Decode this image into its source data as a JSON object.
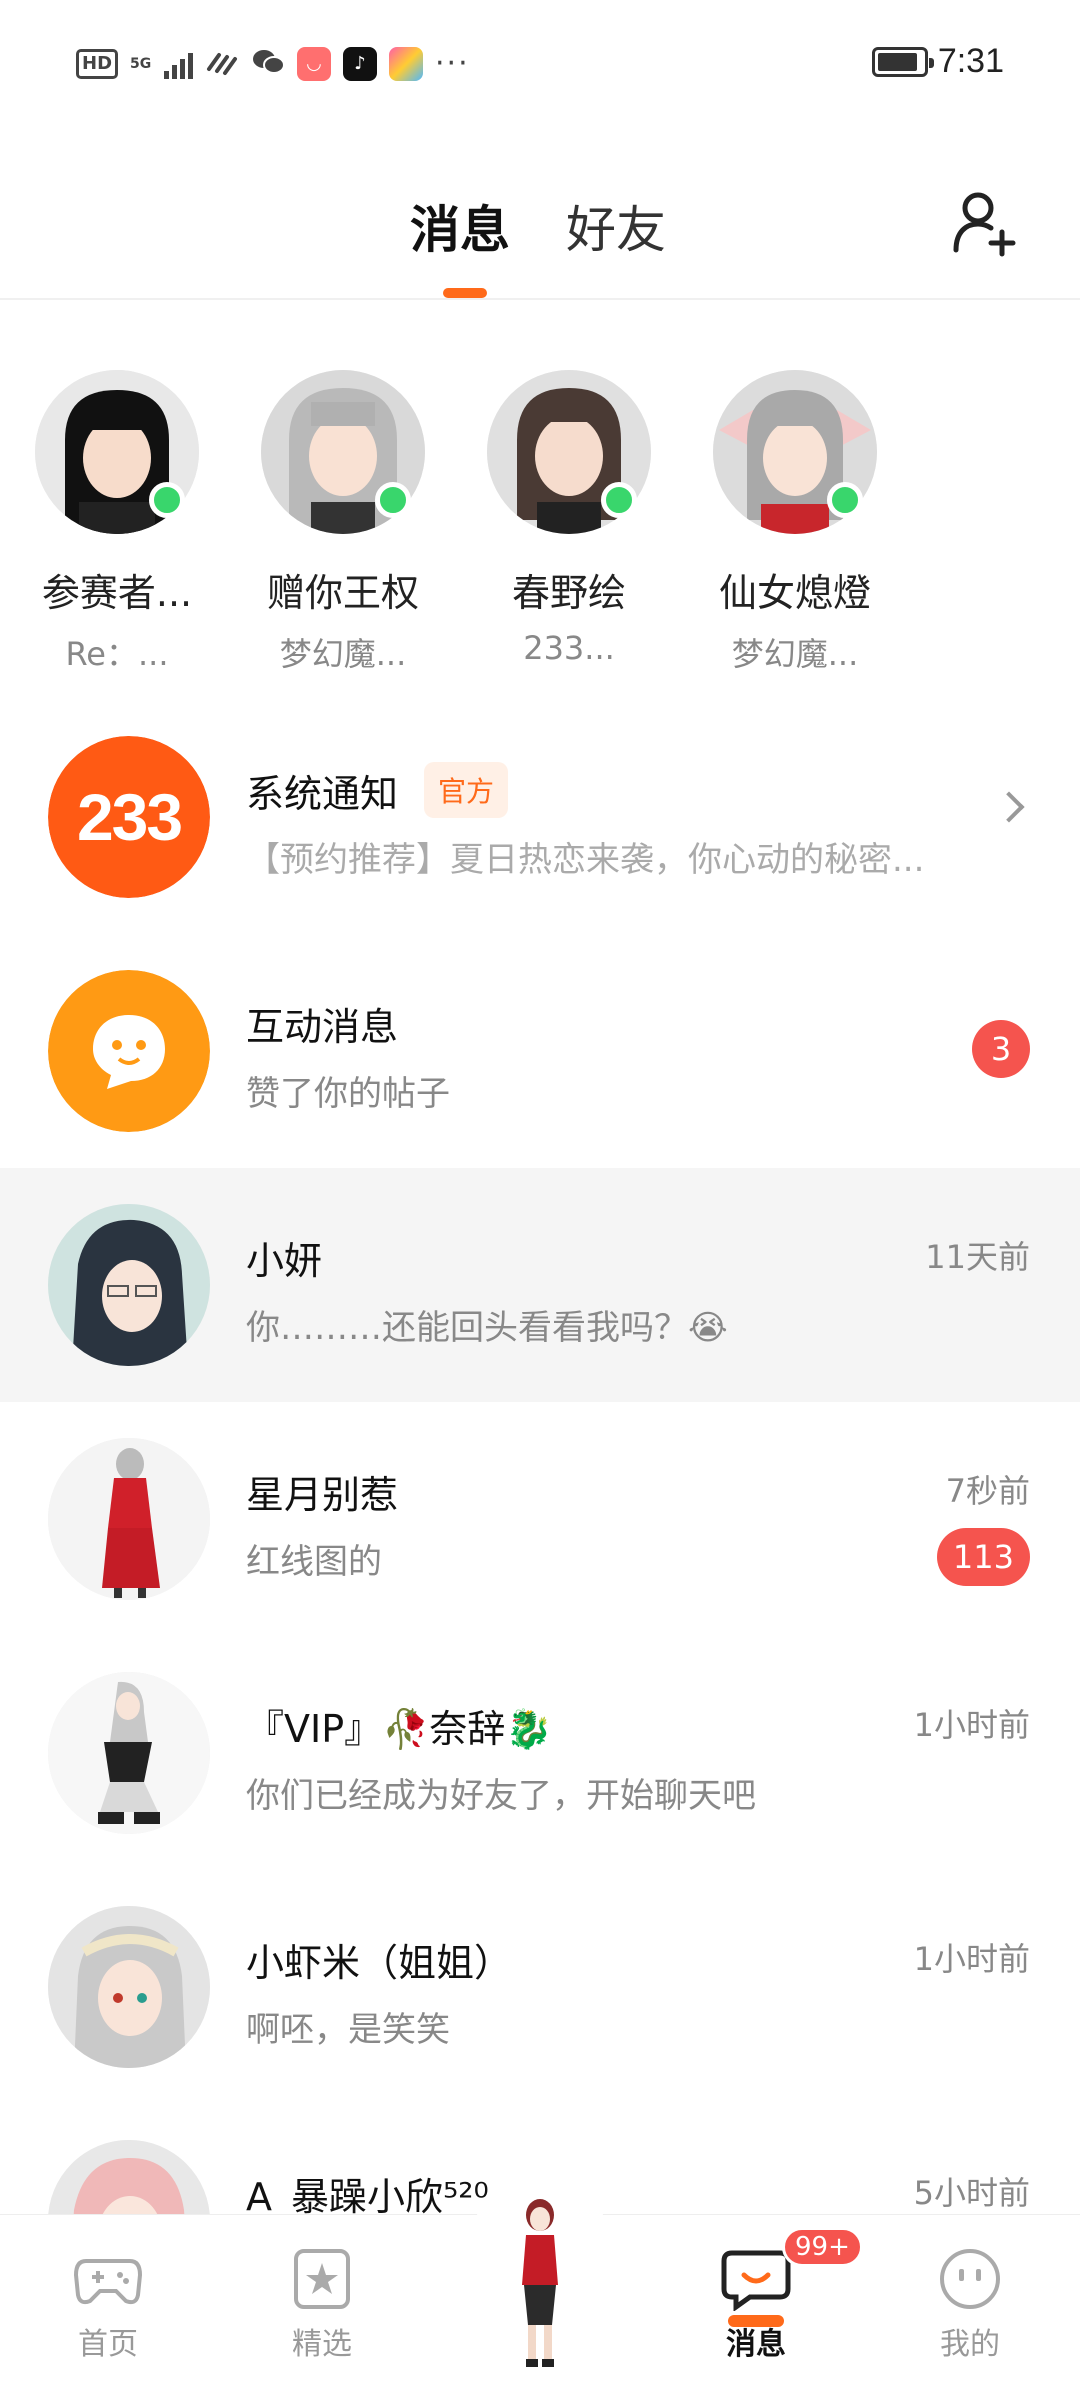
{
  "status_bar": {
    "hd": "HD",
    "network": "5G",
    "time": "7:31",
    "more": "···",
    "battery_level": 0.9
  },
  "header": {
    "tabs": [
      {
        "label": "消息",
        "active": true
      },
      {
        "label": "好友",
        "active": false
      }
    ],
    "add_friend_icon": "add-user-icon"
  },
  "online_friends": [
    {
      "name": "参赛者...",
      "sub": "Re：...",
      "online": true
    },
    {
      "name": "赠你王权",
      "sub": "梦幻魔...",
      "online": true
    },
    {
      "name": "春野绘",
      "sub": "233...",
      "online": true
    },
    {
      "name": "仙女熄燈",
      "sub": "梦幻魔...",
      "online": true
    }
  ],
  "conversations": [
    {
      "title": "系统通知",
      "tag": "官方",
      "message": "【预约推荐】夏日热恋来袭，你心动的秘密...",
      "logo_text": "233"
    },
    {
      "title": "互动消息",
      "message": "赞了你的帖子",
      "unread": "3"
    },
    {
      "title": "小妍",
      "message": "你………还能回头看看我吗？😭",
      "time": "11天前"
    },
    {
      "title": "星月别惹",
      "message": "红线图的",
      "time": "7秒前",
      "unread": "113"
    },
    {
      "title": "『VIP』🥀奈辞🐉",
      "message": "你们已经成为好友了，开始聊天吧",
      "time": "1小时前"
    },
    {
      "title": "小虾米（姐姐）",
      "message": "啊呸，是笑笑",
      "time": "1小时前"
    },
    {
      "title": "A_暴躁小欣⁵²⁰",
      "message": "",
      "time": "5小时前"
    }
  ],
  "bottom_nav": {
    "items": [
      {
        "label": "首页",
        "icon": "gamepad-icon"
      },
      {
        "label": "精选",
        "icon": "star-icon"
      },
      {
        "label": "消息",
        "icon": "chat-icon",
        "badge": "99+",
        "active": true
      },
      {
        "label": "我的",
        "icon": "face-icon"
      }
    ]
  },
  "colors": {
    "accent": "#ff6a1a",
    "online": "#39d66c",
    "badge": "#f5544e",
    "system_logo": "#ff5a14",
    "interaction_logo": "#ff9a14"
  }
}
